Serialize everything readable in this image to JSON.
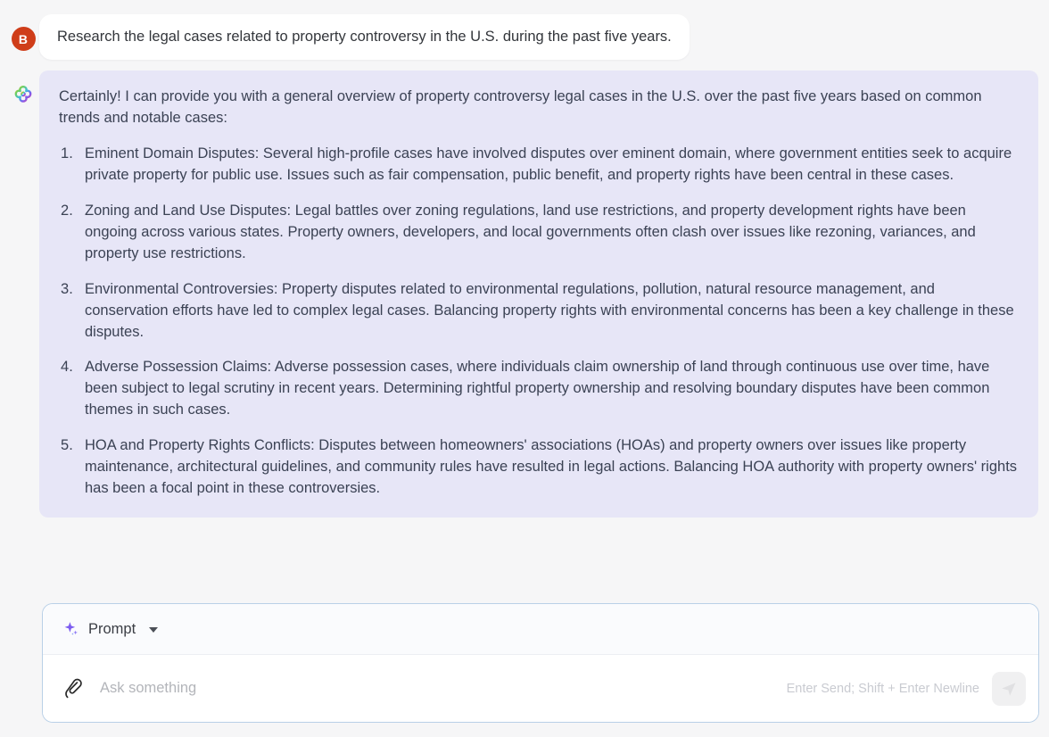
{
  "theme": {
    "page_background": "#f6f6f7",
    "user_bubble_bg": "#ffffff",
    "assistant_bubble_bg": "#e7e6f7",
    "user_avatar_bg": "#cf3d19",
    "composer_border": "#b9d0e7",
    "text_color": "#3b4254",
    "accent_sparkle": "#7c5cf0",
    "send_button_bg": "#f0f0f1"
  },
  "conversation": {
    "messages": [
      {
        "role": "user",
        "avatar_icon": "user-avatar-letter",
        "avatar_letter": "B",
        "text": "Research the legal cases related to property controversy in the U.S. during the past five years."
      },
      {
        "role": "assistant",
        "avatar_icon": "assistant-clover-icon",
        "intro": "Certainly! I can provide you with a general overview of property controversy legal cases in the U.S. over the past five years based on common trends and notable cases:",
        "items": [
          "Eminent Domain Disputes: Several high-profile cases have involved disputes over eminent domain, where government entities seek to acquire private property for public use. Issues such as fair compensation, public benefit, and property rights have been central in these cases.",
          "Zoning and Land Use Disputes: Legal battles over zoning regulations, land use restrictions, and property development rights have been ongoing across various states. Property owners, developers, and local governments often clash over issues like rezoning, variances, and property use restrictions.",
          "Environmental Controversies: Property disputes related to environmental regulations, pollution, natural resource management, and conservation efforts have led to complex legal cases. Balancing property rights with environmental concerns has been a key challenge in these disputes.",
          "Adverse Possession Claims: Adverse possession cases, where individuals claim ownership of land through continuous use over time, have been subject to legal scrutiny in recent years. Determining rightful property ownership and resolving boundary disputes have been common themes in such cases.",
          "HOA and Property Rights Conflicts: Disputes between homeowners' associations (HOAs) and property owners over issues like property maintenance, architectural guidelines, and community rules have resulted in legal actions. Balancing HOA authority with property owners' rights has been a focal point in these controversies."
        ]
      }
    ]
  },
  "composer": {
    "prompt_bar": {
      "icon": "sparkle-icon",
      "label": "Prompt",
      "dropdown_icon": "chevron-down-icon"
    },
    "attach_icon": "paperclip-icon",
    "input": {
      "value": "",
      "placeholder": "Ask something"
    },
    "send_hint": "Enter Send; Shift + Enter Newline",
    "send_button": {
      "icon": "send-plane-icon",
      "enabled": false
    }
  }
}
